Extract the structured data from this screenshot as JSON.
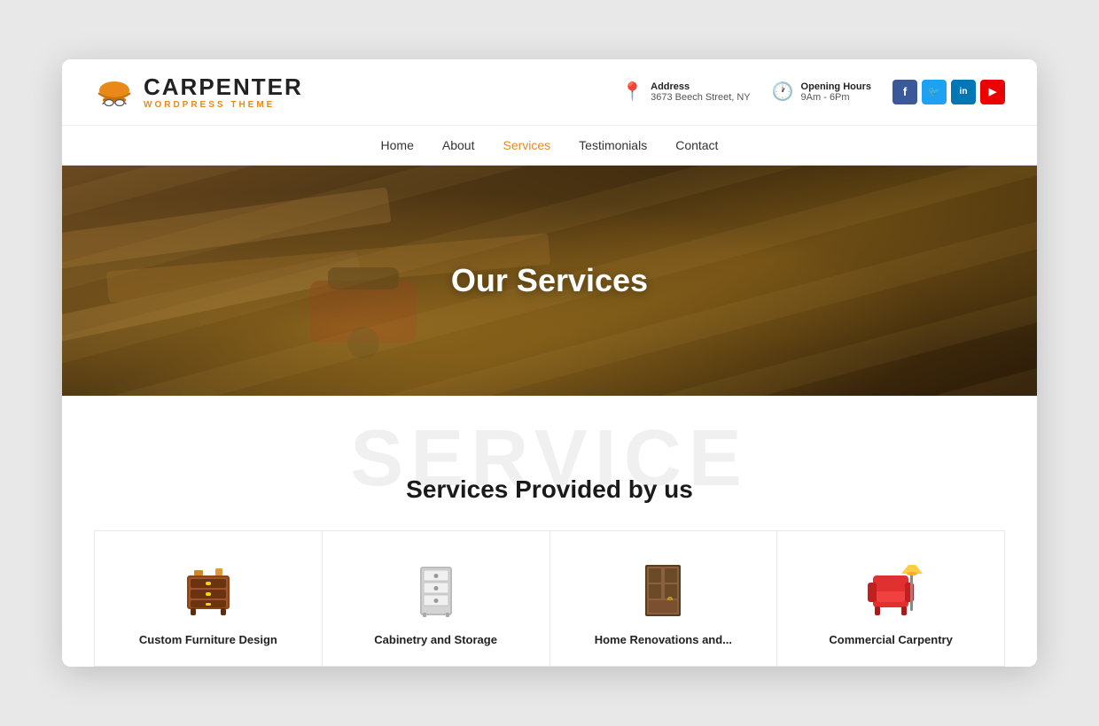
{
  "logo": {
    "title": "CARPENTER",
    "subtitle": "WORDPRESS THEME"
  },
  "header": {
    "address_label": "Address",
    "address_value": "3673 Beech Street, NY",
    "hours_label": "Opening Hours",
    "hours_value": "9Am - 6Pm"
  },
  "social": [
    {
      "name": "facebook",
      "label": "f",
      "class": "social-fb"
    },
    {
      "name": "twitter",
      "label": "t",
      "class": "social-tw"
    },
    {
      "name": "linkedin",
      "label": "in",
      "class": "social-li"
    },
    {
      "name": "youtube",
      "label": "▶",
      "class": "social-yt"
    }
  ],
  "nav": {
    "items": [
      {
        "label": "Home",
        "active": false
      },
      {
        "label": "About",
        "active": false
      },
      {
        "label": "Services",
        "active": true
      },
      {
        "label": "Testimonials",
        "active": false
      },
      {
        "label": "Contact",
        "active": false
      }
    ]
  },
  "hero": {
    "title": "Our Services"
  },
  "services_section": {
    "bg_text": "SERVICE",
    "title": "Services Provided by us"
  },
  "service_cards": [
    {
      "id": "custom-furniture",
      "name": "Custom Furniture Design",
      "icon": "dresser"
    },
    {
      "id": "cabinetry",
      "name": "Cabinetry and Storage",
      "icon": "cabinet"
    },
    {
      "id": "home-renovation",
      "name": "Home Renovations and...",
      "icon": "door"
    },
    {
      "id": "commercial-carpentry",
      "name": "Commercial Carpentry",
      "icon": "armchair"
    }
  ],
  "colors": {
    "accent": "#e8891a",
    "nav_active": "#e8891a"
  }
}
